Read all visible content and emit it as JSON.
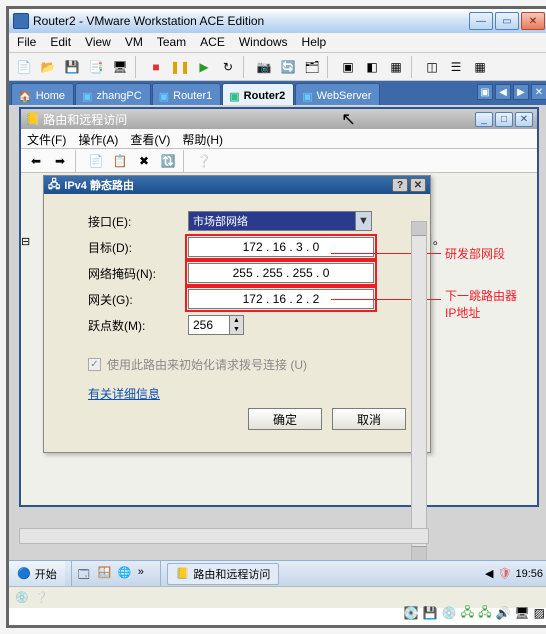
{
  "window": {
    "title": "Router2 - VMware Workstation ACE Edition"
  },
  "menubar": {
    "items": [
      "File",
      "Edit",
      "View",
      "VM",
      "Team",
      "ACE",
      "Windows",
      "Help"
    ]
  },
  "tabs": {
    "items": [
      {
        "label": "Home",
        "active": false
      },
      {
        "label": "zhangPC",
        "active": false
      },
      {
        "label": "Router1",
        "active": false
      },
      {
        "label": "Router2",
        "active": true
      },
      {
        "label": "WebServer",
        "active": false
      }
    ]
  },
  "rras": {
    "title": "路由和远程访问",
    "menu": {
      "file": "文件(F)",
      "action": "操作(A)",
      "view": "查看(V)",
      "help": "帮助(H)"
    },
    "body_hint": "目。"
  },
  "dialog": {
    "title": "IPv4 静态路由",
    "labels": {
      "interface": "接口(E):",
      "dest": "目标(D):",
      "mask": "网络掩码(N):",
      "gateway": "网关(G):",
      "metric": "跃点数(M):"
    },
    "values": {
      "interface": "市场部网络",
      "dest": "172 . 16 .  3  .  0",
      "mask": "255 . 255 . 255 .  0",
      "gateway": "172 . 16 .  2  .  2",
      "metric": "256"
    },
    "checkbox": "使用此路由来初始化请求拨号连接 (U)",
    "link": "有关详细信息",
    "ok": "确定",
    "cancel": "取消"
  },
  "annotations": {
    "a1": "研发部网段",
    "a2": "下一跳路由器IP地址"
  },
  "taskbar": {
    "start": "开始",
    "task": "路由和远程访问",
    "time": "19:56"
  }
}
